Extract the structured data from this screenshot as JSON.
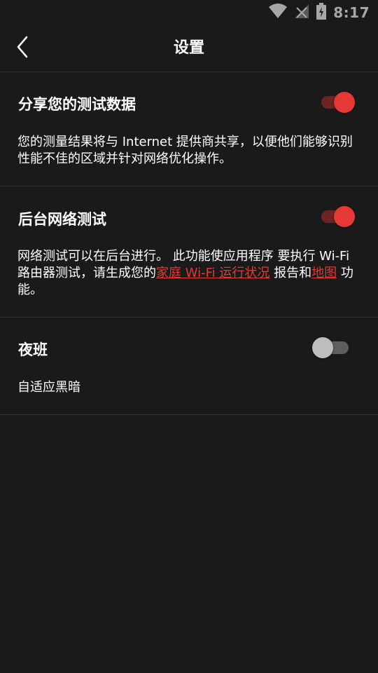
{
  "status_bar": {
    "time": "8:17",
    "icons": [
      "wifi-icon",
      "no-signal-icon",
      "battery-charging-icon"
    ]
  },
  "toolbar": {
    "title": "设置",
    "back_icon": "chevron-left-icon"
  },
  "settings": [
    {
      "title": "分享您的测试数据",
      "toggle_on": true,
      "description": "您的测量结果将与 Internet 提供商共享，以便他们能够识别性能不佳的区域并针对网络优化操作。"
    },
    {
      "title": "后台网络测试",
      "toggle_on": true,
      "description_part1": "网络测试可以在后台进行。 此功能使应用程序 要执行 Wi-Fi 路由器测试，请生成您的",
      "link1": "家庭 Wi-Fi 运行状况",
      "description_part2": " 报告和",
      "link2": "地图",
      "description_part3": " 功能。"
    },
    {
      "title": "夜班",
      "toggle_on": false,
      "description": "自适应黑暗"
    }
  ],
  "colors": {
    "background": "#1a1a1a",
    "accent": "#e53935",
    "divider": "#333333"
  }
}
